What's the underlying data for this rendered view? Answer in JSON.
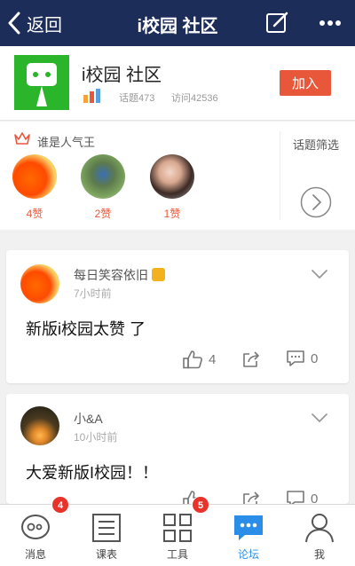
{
  "nav": {
    "back_label": "返回",
    "title": "i校园 社区"
  },
  "community": {
    "name": "i校园 社区",
    "topics": "话题473",
    "visits": "访问42536",
    "join_label": "加入"
  },
  "popular": {
    "title": "谁是人气王",
    "users": [
      {
        "likes": "4赞"
      },
      {
        "likes": "2赞"
      },
      {
        "likes": "1赞"
      }
    ],
    "filter_label": "话题筛选"
  },
  "posts": [
    {
      "author": "每日笑容依旧",
      "time": "7小时前",
      "text": "新版i校园太赞 了",
      "likes": "4",
      "comments": "0"
    },
    {
      "author": "小&A",
      "time": "10小时前",
      "text": "大爱新版I校园！！",
      "likes": "",
      "comments": "0"
    }
  ],
  "tabs": [
    {
      "label": "消息",
      "icon": "message-icon",
      "badge": "4"
    },
    {
      "label": "课表",
      "icon": "schedule-icon"
    },
    {
      "label": "工具",
      "icon": "tools-icon",
      "badge": "5"
    },
    {
      "label": "论坛",
      "icon": "forum-icon",
      "active": true
    },
    {
      "label": "我",
      "icon": "profile-icon"
    }
  ],
  "colors": {
    "nav_bg": "#1c2d59",
    "accent": "#e8573a",
    "active_tab": "#2a8ee8",
    "logo_green": "#2bb52b"
  }
}
